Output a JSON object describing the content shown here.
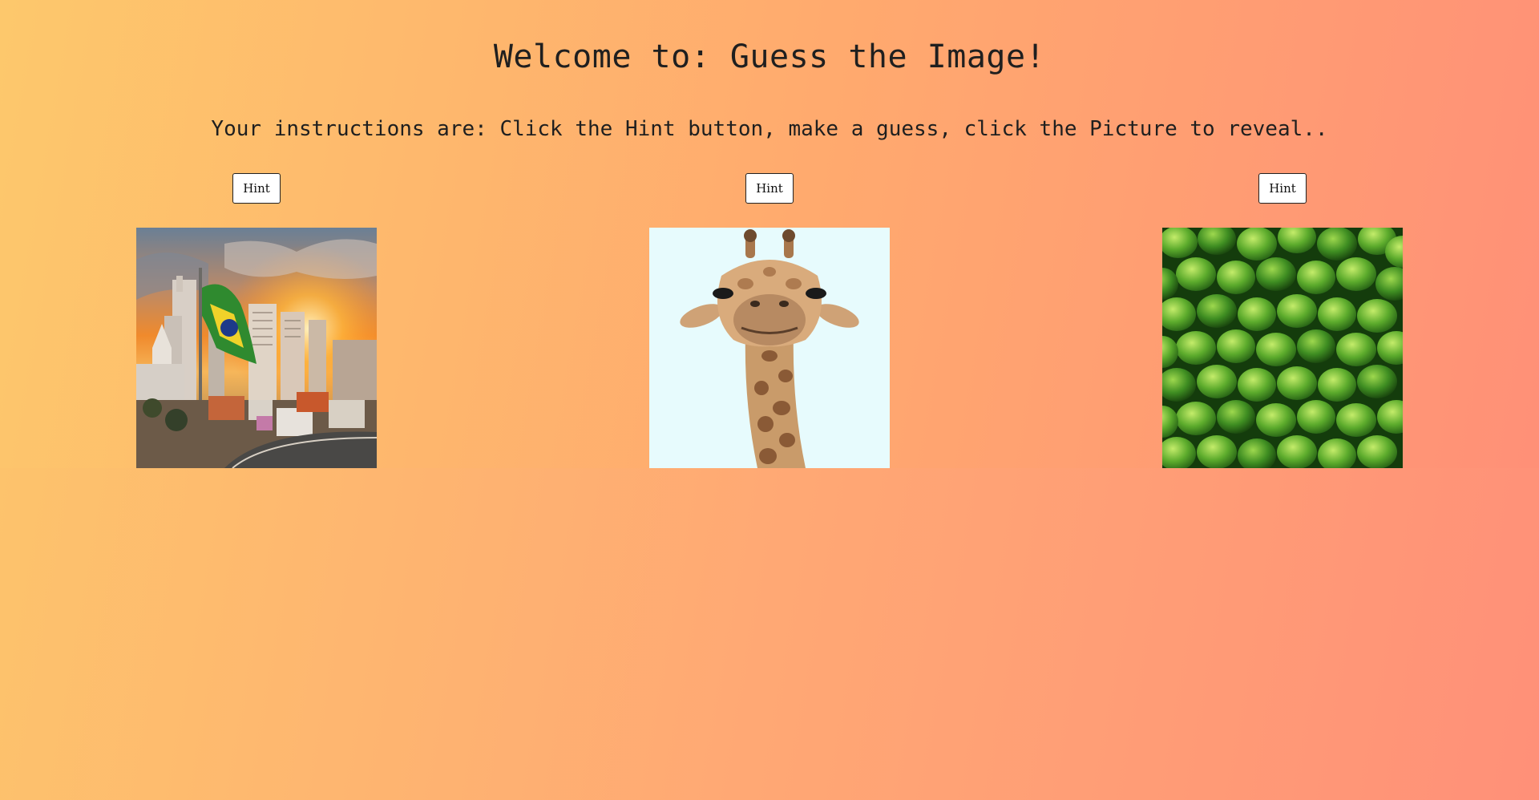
{
  "header": {
    "title": "Welcome to: Guess the Image!",
    "instructions": "Your instructions are: Click the Hint button, make a guess, click the Picture to reveal.."
  },
  "cards": [
    {
      "hint_label": "Hint",
      "picture": "city-skyline-with-flag-image"
    },
    {
      "hint_label": "Hint",
      "picture": "giraffe-image"
    },
    {
      "hint_label": "Hint",
      "picture": "limes-image"
    }
  ],
  "colors": {
    "background_start": "#fdc86c",
    "background_end": "#ff8e78",
    "text": "#1f1f1f",
    "button_bg": "#ffffff"
  }
}
